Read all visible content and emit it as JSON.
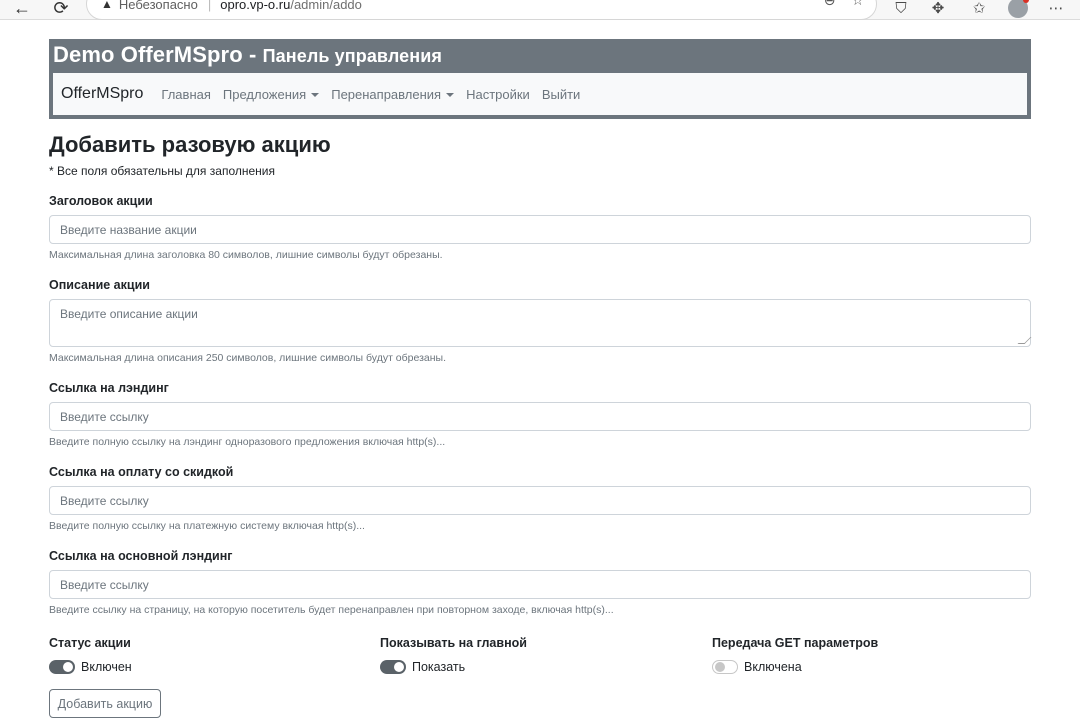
{
  "browser": {
    "back_icon": "←",
    "refresh_icon": "⟳",
    "warning_icon": "▲",
    "insecure_label": "Небезопасно",
    "url_host": "opro.vp-o.ru",
    "url_path": "/admin/addo",
    "zoom_icon": "⊖",
    "star_icon": "☆",
    "shield_icon": "⛉",
    "extensions_icon": "✥",
    "favorites_icon": "✩",
    "menu_icon": "⋯"
  },
  "header": {
    "title_main": "Demo OfferMSpro",
    "title_dash": " - ",
    "title_sub": "Панель управления"
  },
  "navbar": {
    "brand": "OfferMSpro",
    "items": [
      {
        "label": "Главная"
      },
      {
        "label": "Предложения"
      },
      {
        "label": "Перенаправления"
      },
      {
        "label": "Настройки"
      },
      {
        "label": "Выйти"
      }
    ]
  },
  "form": {
    "page_title": "Добавить разовую акцию",
    "required_note": "* Все поля обязательны для заполнения",
    "fields": [
      {
        "label": "Заголовок акции",
        "placeholder": "Введите название акции",
        "help": "Максимальная длина заголовка 80 символов, лишние символы будут обрезаны."
      },
      {
        "label": "Описание акции",
        "placeholder": "Введите описание акции",
        "help": "Максимальная длина описания 250 символов, лишние символы будут обрезаны."
      },
      {
        "label": "Ссылка на лэндинг",
        "placeholder": "Введите ссылку",
        "help": "Введите полную ссылку на лэндинг одноразового предложения включая http(s)..."
      },
      {
        "label": "Ссылка на оплату со скидкой",
        "placeholder": "Введите ссылку",
        "help": "Введите полную ссылку на платежную систему включая http(s)..."
      },
      {
        "label": "Ссылка на основной лэндинг",
        "placeholder": "Введите ссылку",
        "help": "Введите ссылку на страницу, на которую посетитель будет перенаправлен при повторном заходе, включая http(s)..."
      }
    ],
    "toggles": [
      {
        "label": "Статус акции",
        "text": "Включен",
        "checked": true
      },
      {
        "label": "Показывать на главной",
        "text": "Показать",
        "checked": true
      },
      {
        "label": "Передача GET параметров",
        "text": "Включена",
        "checked": false
      }
    ],
    "submit_label": "Добавить акцию"
  }
}
